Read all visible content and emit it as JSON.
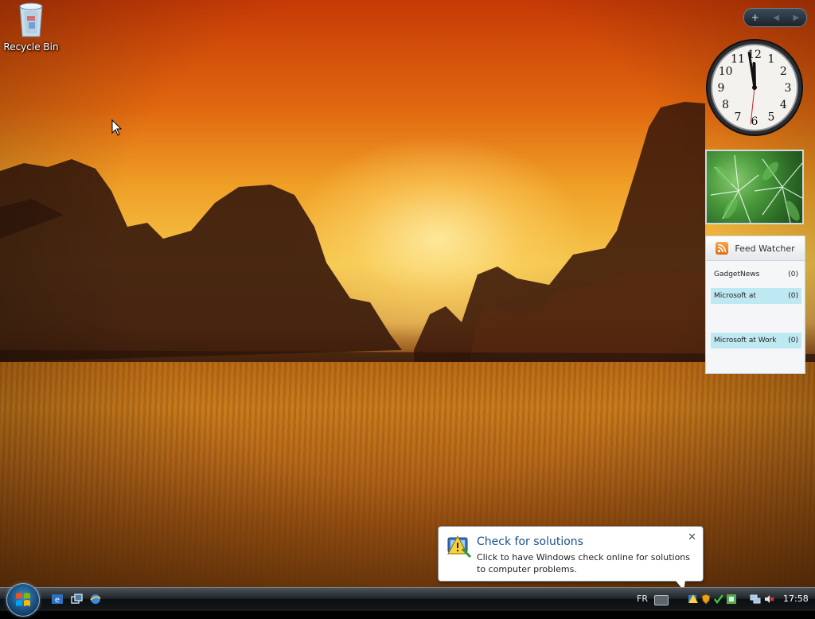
{
  "desktop": {
    "icons": [
      {
        "label": "Recycle Bin",
        "icon": "recycle-bin-icon"
      }
    ]
  },
  "sidebar": {
    "add_label": "+",
    "prev_label": "◀",
    "next_label": "▶",
    "clock": {
      "hour": 11,
      "minute": 58,
      "second": 31
    },
    "feed_watcher": {
      "title": "Feed Watcher",
      "feeds": [
        {
          "name": "GadgetNews",
          "count": "(0)",
          "highlighted": false
        },
        {
          "name": "Microsoft at",
          "count": "(0)",
          "highlighted": true
        },
        {
          "name": "Microsoft at Work",
          "count": "(0)",
          "highlighted": true
        }
      ]
    }
  },
  "notification": {
    "title": "Check for solutions",
    "text": "Click to have Windows check online for solutions to computer problems.",
    "close_label": "✕"
  },
  "taskbar": {
    "language": "FR",
    "time": "17:58"
  },
  "colors": {
    "balloon_title": "#1a4f8e",
    "feed_highlight": "#bfe9f2"
  }
}
